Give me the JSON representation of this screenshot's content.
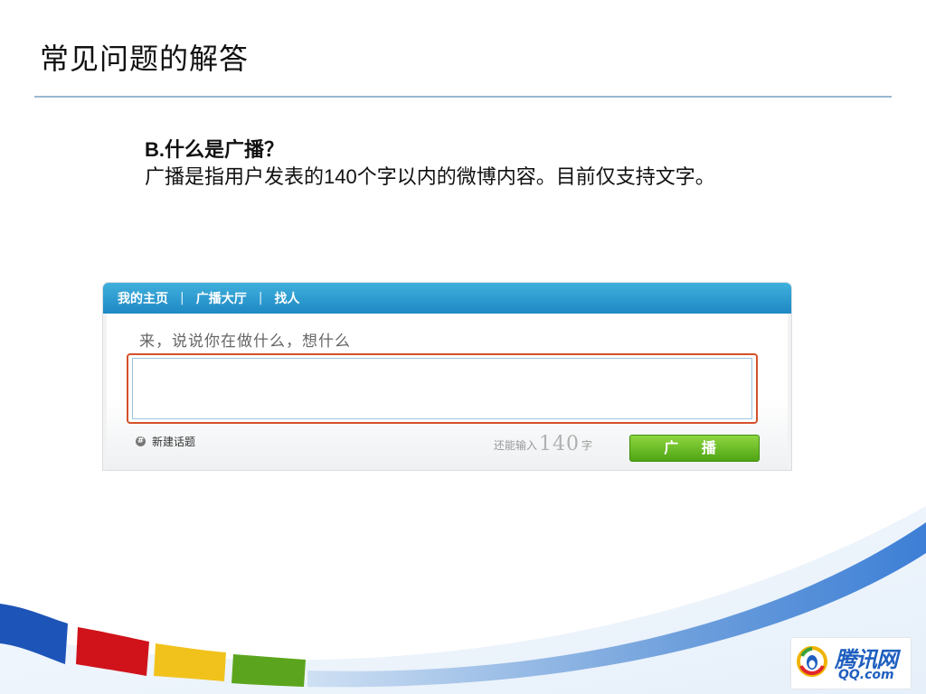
{
  "slide": {
    "title": "常见问题的解答",
    "question": "B.什么是广播？",
    "answer": "广播是指用户发表的140个字以内的微博内容。目前仅支持文字。"
  },
  "screenshot": {
    "nav": {
      "items": [
        "我的主页",
        "广播大厅",
        "找人"
      ],
      "separator": "|"
    },
    "compose": {
      "prompt": "来，说说你在做什么，想什么",
      "value": ""
    },
    "footer": {
      "new_topic_label": "新建话题",
      "counter_prefix": "还能输入",
      "counter_value": "140",
      "counter_suffix": "字",
      "post_button": "广 播"
    }
  },
  "logo": {
    "wordmark": "腾讯网",
    "domain": "QQ.com"
  },
  "colors": {
    "nav_blue": "#1e88c4",
    "compose_border": "#d4512a",
    "post_button_green": "#5bb51c",
    "logo_blue": "#1f5fbf"
  }
}
